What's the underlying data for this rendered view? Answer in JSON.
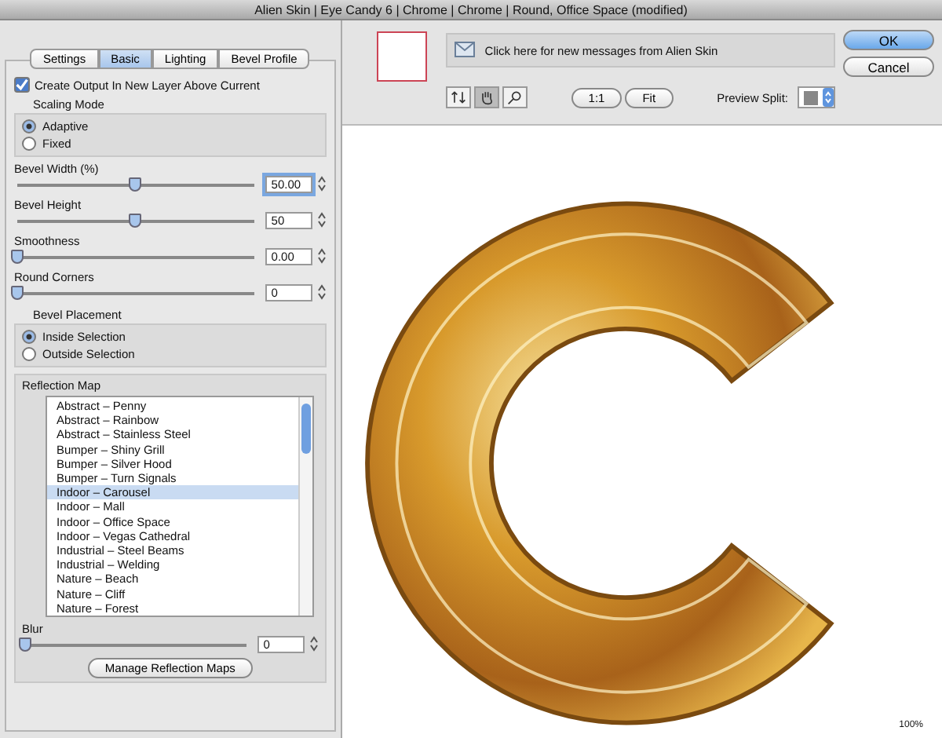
{
  "window": {
    "title": "Alien Skin | Eye Candy 6 | Chrome | Chrome | Round, Office Space (modified)"
  },
  "tabs": [
    {
      "label": "Settings",
      "selected": false
    },
    {
      "label": "Basic",
      "selected": true
    },
    {
      "label": "Lighting",
      "selected": false
    },
    {
      "label": "Bevel Profile",
      "selected": false
    }
  ],
  "create_output": {
    "label": "Create Output In New Layer Above Current",
    "checked": true
  },
  "scaling_mode": {
    "title": "Scaling Mode",
    "options": [
      {
        "label": "Adaptive",
        "selected": true
      },
      {
        "label": "Fixed",
        "selected": false
      }
    ]
  },
  "sliders": [
    {
      "label": "Bevel Width (%)",
      "value": "50.00",
      "level": 0.5,
      "focused": true
    },
    {
      "label": "Bevel Height",
      "value": "50",
      "level": 0.5,
      "focused": false
    },
    {
      "label": "Smoothness",
      "value": "0.00",
      "level": 0,
      "focused": false
    },
    {
      "label": "Round Corners",
      "value": "0",
      "level": 0,
      "focused": false
    }
  ],
  "bevel_placement": {
    "title": "Bevel Placement",
    "options": [
      {
        "label": "Inside Selection",
        "selected": true
      },
      {
        "label": "Outside Selection",
        "selected": false
      }
    ]
  },
  "reflection_map": {
    "title": "Reflection Map",
    "items": [
      {
        "label": "Abstract – Penny",
        "selected": false
      },
      {
        "label": "Abstract – Rainbow",
        "selected": false
      },
      {
        "label": "Abstract – Stainless Steel",
        "selected": false
      },
      {
        "label": "Bumper – Shiny Grill",
        "selected": false
      },
      {
        "label": "Bumper – Silver Hood",
        "selected": false
      },
      {
        "label": "Bumper – Turn Signals",
        "selected": false
      },
      {
        "label": "Indoor – Carousel",
        "selected": true
      },
      {
        "label": "Indoor – Mall",
        "selected": false
      },
      {
        "label": "Indoor – Office Space",
        "selected": false
      },
      {
        "label": "Indoor – Vegas Cathedral",
        "selected": false
      },
      {
        "label": "Industrial – Steel Beams",
        "selected": false
      },
      {
        "label": "Industrial – Welding",
        "selected": false
      },
      {
        "label": "Nature – Beach",
        "selected": false
      },
      {
        "label": "Nature – Cliff",
        "selected": false
      },
      {
        "label": "Nature – Forest",
        "selected": false
      }
    ],
    "blur": {
      "label": "Blur",
      "value": "0",
      "level": 0
    },
    "manage_button": "Manage Reflection Maps"
  },
  "message_bar": "Click here for new messages from Alien Skin",
  "buttons": [
    "OK",
    "Cancel"
  ],
  "zoom_buttons": [
    "1:1",
    "Fit"
  ],
  "preview_split_label": "Preview Split:",
  "zoom_level": "100%"
}
